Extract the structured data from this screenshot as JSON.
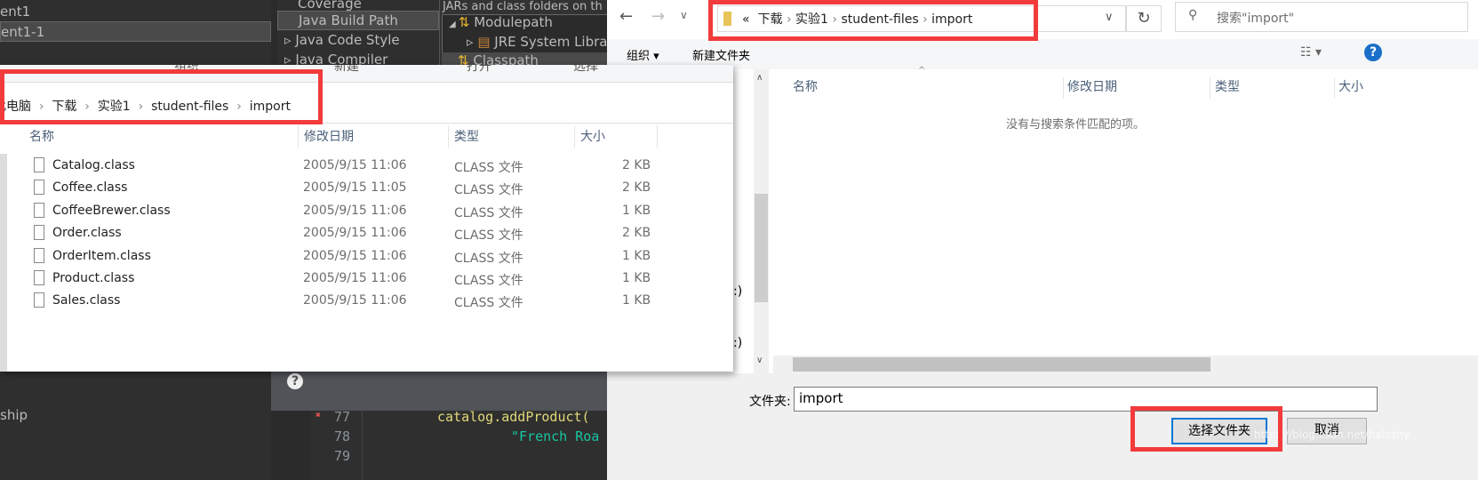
{
  "eclipse": {
    "project_items": [
      "ent1",
      "ent1-1"
    ],
    "partial_item": "ship",
    "properties_items": [
      "Coverage",
      "Java Build Path",
      "Java Code Style",
      "Java Compiler"
    ],
    "selected_property": "Java Build Path",
    "build_path_caption": "JARs and class folders on th",
    "tree": [
      "Modulepath",
      "JRE System Library",
      "Classpath"
    ],
    "code_lines": [
      {
        "num": "77",
        "code": "catalog.addProduct("
      },
      {
        "num": "78",
        "code": "\"French Roa"
      },
      {
        "num": "79",
        "code": ""
      }
    ]
  },
  "explorer": {
    "toolbar": [
      "组织",
      "新建",
      "打开",
      "选择"
    ],
    "breadcrumb": [
      "此电脑",
      "下载",
      "实验1",
      "student-files",
      "import"
    ],
    "columns": [
      "名称",
      "修改日期",
      "类型",
      "大小"
    ],
    "files": [
      {
        "name": "Catalog.class",
        "date": "2005/9/15 11:06",
        "type": "CLASS 文件",
        "size": "2 KB"
      },
      {
        "name": "Coffee.class",
        "date": "2005/9/15 11:05",
        "type": "CLASS 文件",
        "size": "2 KB"
      },
      {
        "name": "CoffeeBrewer.class",
        "date": "2005/9/15 11:06",
        "type": "CLASS 文件",
        "size": "1 KB"
      },
      {
        "name": "Order.class",
        "date": "2005/9/15 11:06",
        "type": "CLASS 文件",
        "size": "2 KB"
      },
      {
        "name": "OrderItem.class",
        "date": "2005/9/15 11:06",
        "type": "CLASS 文件",
        "size": "1 KB"
      },
      {
        "name": "Product.class",
        "date": "2005/9/15 11:06",
        "type": "CLASS 文件",
        "size": "1 KB"
      },
      {
        "name": "Sales.class",
        "date": "2005/9/15 11:06",
        "type": "CLASS 文件",
        "size": "1 KB"
      }
    ]
  },
  "dialog": {
    "breadcrumb": [
      "«",
      "下载",
      "实验1",
      "student-files",
      "import"
    ],
    "search_placeholder": "搜索\"import\"",
    "organize": "组织 ▾",
    "new_folder": "新建文件夹",
    "columns": [
      "名称",
      "修改日期",
      "类型",
      "大小"
    ],
    "empty_message": "没有与搜索条件匹配的项。",
    "folder_label": "文件夹:",
    "folder_value": "import",
    "select_button": "选择文件夹",
    "cancel_button": "取消",
    "watermark": "https://blog.csdn.net/halozhy"
  },
  "colors": {
    "highlight": "#f23b3b",
    "accent": "#0078d7"
  }
}
